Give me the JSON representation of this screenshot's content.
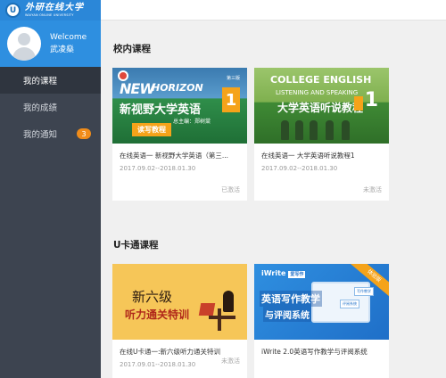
{
  "brand": {
    "emblem": "U",
    "name_cn": "外研在线大学",
    "name_en": "WAIYAN ONLINE UNIVERSITY"
  },
  "user": {
    "greeting": "Welcome",
    "name": "武凌燊"
  },
  "nav": [
    {
      "label": "我的课程",
      "active": true
    },
    {
      "label": "我的成绩",
      "active": false
    },
    {
      "label": "我的通知",
      "active": false,
      "badge": "3"
    }
  ],
  "sections": [
    {
      "title": "校内课程",
      "cards": [
        {
          "title": "在线英语一 新视野大学英语（第三...",
          "date": "2017.09.02--2018.01.30",
          "status": "已激活",
          "cover": {
            "line1": "NEW",
            "line2": "HORIZON",
            "edition": "第三版",
            "cn": "新视野大学英语",
            "num": "1",
            "author": "总主编：郑树棠",
            "tag": "读写教程"
          }
        },
        {
          "title": "在线英语一 大学英语听说教程1",
          "date": "2017.09.02--2018.01.30",
          "status": "未激活",
          "cover": {
            "line1": "COLLEGE ENGLISH",
            "line2": "LISTENING AND SPEAKING",
            "cn": "大学英语听说教程",
            "num": "1"
          }
        }
      ]
    },
    {
      "title": "U卡通课程",
      "cards": [
        {
          "title": "在线U卡通一:新六级听力通关特训",
          "date": "2017.09.01--2018.01.30",
          "status": "未激活",
          "cover": {
            "line1": "新六级",
            "line2": "听力通关特训"
          }
        },
        {
          "title": "iWrite 2.0英语写作教学与评阅系统",
          "date": "",
          "status": "",
          "cover": {
            "brand": "iWrite",
            "brand_tag": "爱写作",
            "ribbon": "体验版",
            "t1": "英语写作教学",
            "t2": "与评阅系统",
            "chip1": "写作教学",
            "chip2": "评阅系统"
          }
        }
      ]
    }
  ],
  "colors": {
    "sidebar": "#3d4450",
    "brand_bar": "#2b87d8",
    "user_panel": "#2e8fe0",
    "badge": "#f08c1a",
    "accent_orange": "#f5a31a"
  },
  "icons": [
    "university-emblem-icon",
    "user-avatar-icon"
  ]
}
